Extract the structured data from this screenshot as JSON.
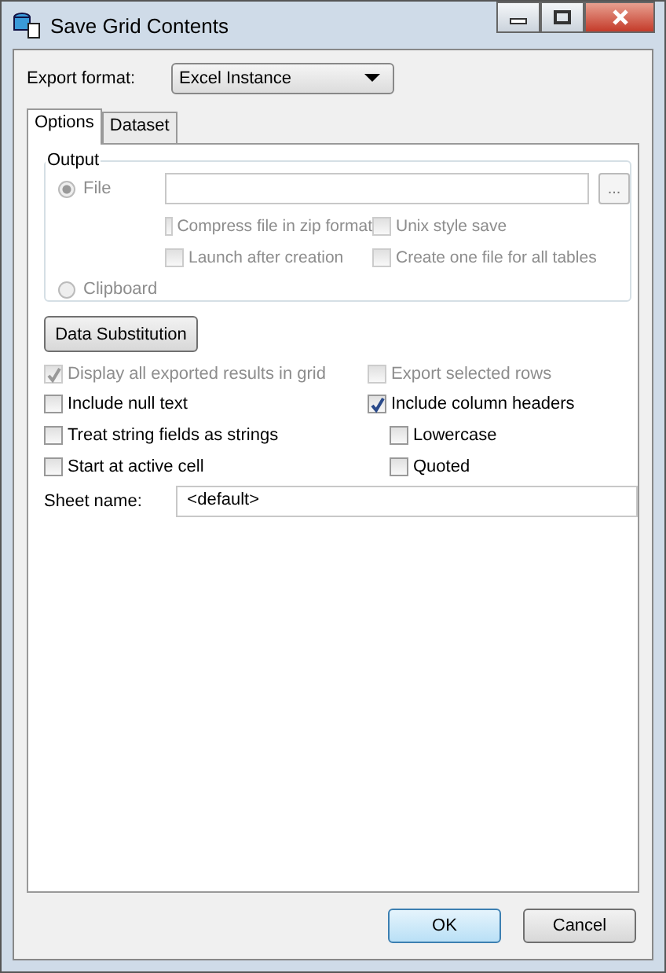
{
  "window": {
    "title": "Save Grid Contents"
  },
  "export_format": {
    "label": "Export format:",
    "value": "Excel Instance"
  },
  "tabs": [
    {
      "label": "Options",
      "selected": true
    },
    {
      "label": "Dataset",
      "selected": false
    }
  ],
  "output": {
    "title": "Output",
    "radios": [
      {
        "label": "File",
        "selected": true,
        "disabled": true
      },
      {
        "label": "Clipboard",
        "selected": false,
        "disabled": true
      }
    ],
    "browse": "...",
    "file_options": [
      {
        "label": "Compress file in zip format",
        "checked": false,
        "disabled": true
      },
      {
        "label": "Unix style save",
        "checked": false,
        "disabled": true
      },
      {
        "label": "Launch after creation",
        "checked": false,
        "disabled": true
      },
      {
        "label": "Create one file for all tables",
        "checked": false,
        "disabled": true
      }
    ]
  },
  "data_substitution": "Data Substitution",
  "left_options": [
    {
      "label": "Display all exported results in grid",
      "checked": true,
      "disabled": true
    },
    {
      "label": "Include null text",
      "checked": false,
      "disabled": false
    },
    {
      "label": "Treat string fields as strings",
      "checked": false,
      "disabled": false
    },
    {
      "label": "Start at active cell",
      "checked": false,
      "disabled": false
    }
  ],
  "right_options": [
    {
      "label": "Export selected rows",
      "checked": false,
      "disabled": true
    },
    {
      "label": "Include column headers",
      "checked": true,
      "disabled": false,
      "children": [
        {
          "label": "Lowercase",
          "checked": false,
          "disabled": false
        },
        {
          "label": "Quoted",
          "checked": false,
          "disabled": false
        }
      ]
    }
  ],
  "sheet_name": {
    "label": "Sheet name:",
    "value": "<default>"
  },
  "buttons": [
    "OK",
    "Cancel"
  ]
}
